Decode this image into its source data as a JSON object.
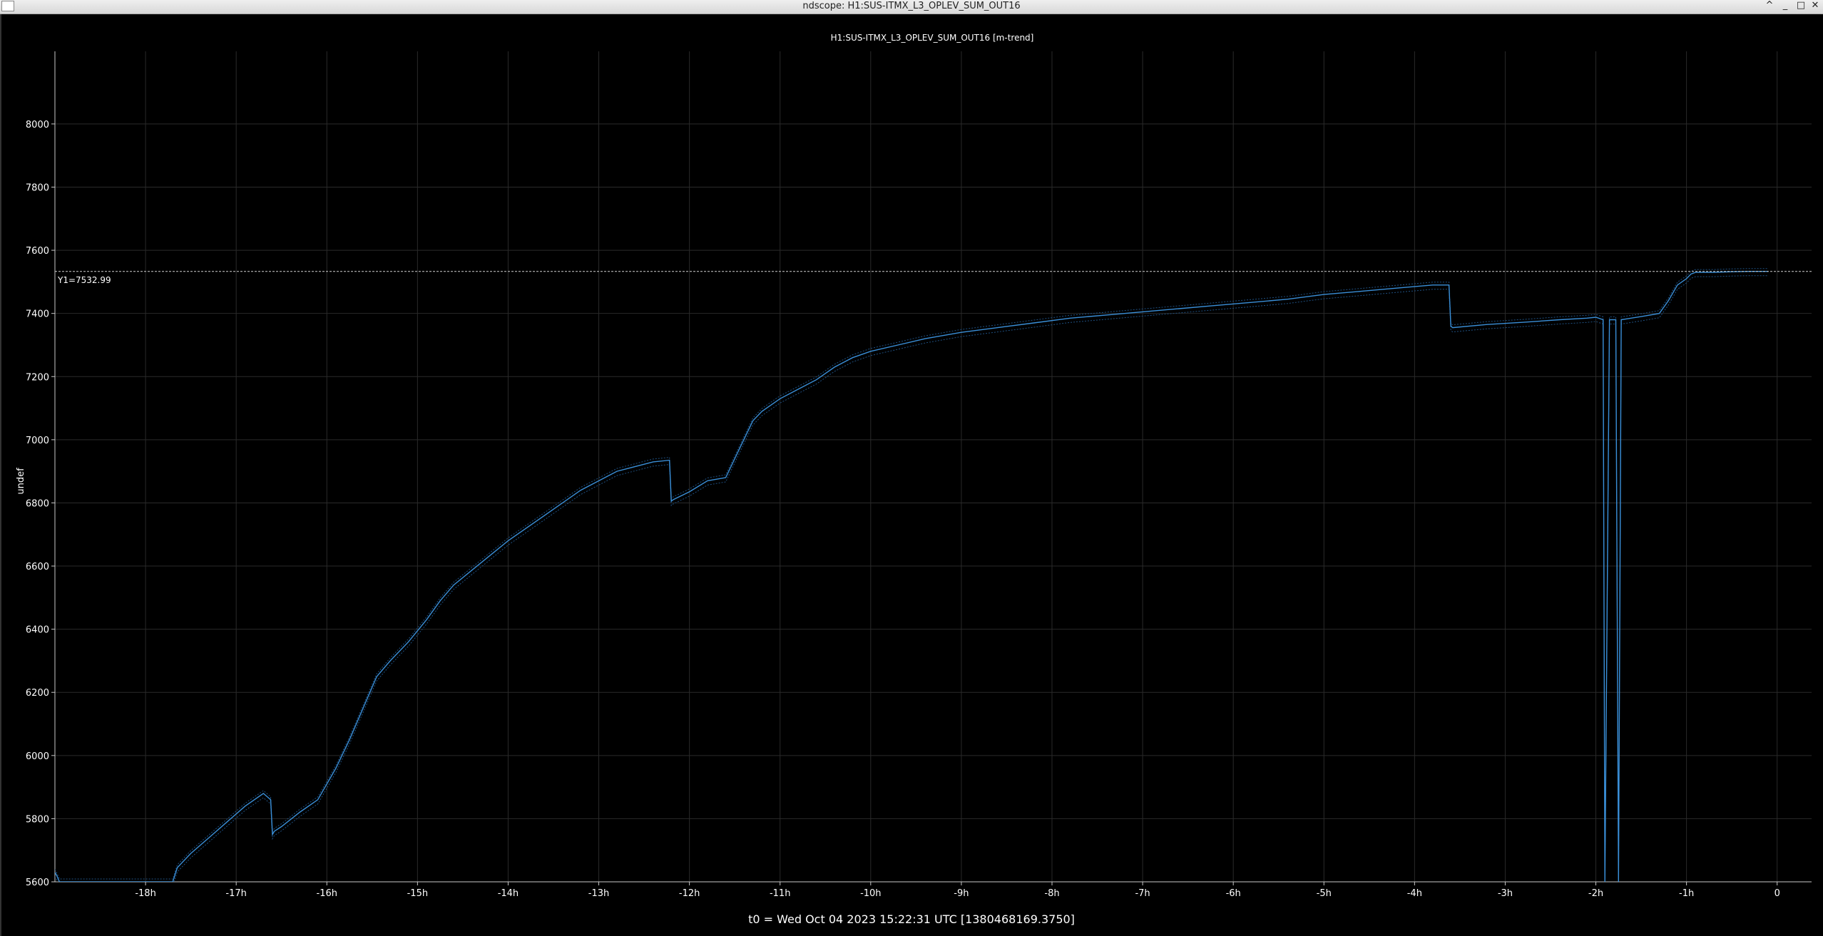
{
  "window": {
    "title": "ndscope: H1:SUS-ITMX_L3_OPLEV_SUM_OUT16",
    "buttons": [
      "^",
      "_",
      "□",
      "✕"
    ]
  },
  "plot": {
    "title": "H1:SUS-ITMX_L3_OPLEV_SUM_OUT16 [m-trend]",
    "ylabel": "undef",
    "cursor_label": "Y1=7532.99",
    "footer": "t0 = Wed Oct 04 2023 15:22:31 UTC [1380468169.3750]",
    "colors": {
      "background": "#000000",
      "trace": "#3a8fd8",
      "trace_dim": "#1e4f80",
      "axis": "#c8c8c8",
      "grid": "#2a2a2a",
      "cursor": "#d0d0d0"
    }
  },
  "chart_data": {
    "type": "line",
    "xlabel": "",
    "ylabel": "undef",
    "xlim": [
      -19.0,
      0.38
    ],
    "ylim": [
      5600,
      8230
    ],
    "xticks": [
      -18,
      -17,
      -16,
      -15,
      -14,
      -13,
      -12,
      -11,
      -10,
      -9,
      -8,
      -7,
      -6,
      -5,
      -4,
      -3,
      -2,
      -1,
      0
    ],
    "xtick_labels": [
      "-18h",
      "-17h",
      "-16h",
      "-15h",
      "-14h",
      "-13h",
      "-12h",
      "-11h",
      "-10h",
      "-9h",
      "-8h",
      "-7h",
      "-6h",
      "-5h",
      "-4h",
      "-3h",
      "-2h",
      "-1h",
      "0"
    ],
    "yticks": [
      5600,
      5800,
      6000,
      6200,
      6400,
      6600,
      6800,
      7000,
      7200,
      7400,
      7600,
      7800,
      8000
    ],
    "ytick_labels": [
      "5600",
      "5800",
      "6000",
      "6200",
      "6400",
      "6600",
      "6800",
      "7000",
      "7200",
      "7400",
      "7600",
      "7800",
      "8000"
    ],
    "grid": true,
    "cursor_y": 7532.99,
    "x_unit": "hours relative to t0",
    "series": [
      {
        "role": "mean",
        "x": [
          -19.0,
          -18.98,
          -18.95,
          -17.7,
          -17.65,
          -17.5,
          -17.3,
          -17.1,
          -16.9,
          -16.7,
          -16.62,
          -16.6,
          -16.58,
          -16.5,
          -16.3,
          -16.1,
          -15.9,
          -15.75,
          -15.6,
          -15.45,
          -15.3,
          -15.1,
          -14.9,
          -14.75,
          -14.6,
          -14.3,
          -14.0,
          -13.6,
          -13.2,
          -12.8,
          -12.4,
          -12.22,
          -12.2,
          -12.18,
          -12.0,
          -11.8,
          -11.6,
          -11.45,
          -11.3,
          -11.2,
          -11.0,
          -10.8,
          -10.6,
          -10.4,
          -10.2,
          -10.0,
          -9.7,
          -9.4,
          -9.0,
          -8.6,
          -8.2,
          -7.8,
          -7.4,
          -7.0,
          -6.6,
          -6.2,
          -5.8,
          -5.4,
          -5.0,
          -4.6,
          -4.2,
          -3.8,
          -3.62,
          -3.6,
          -3.58,
          -3.2,
          -2.8,
          -2.4,
          -2.1,
          -2.0,
          -1.92,
          -1.9,
          -1.85,
          -1.78,
          -1.75,
          -1.72,
          -1.5,
          -1.3,
          -1.2,
          -1.1,
          -1.0,
          -0.95,
          -0.9,
          -0.7,
          -0.5,
          -0.3,
          -0.1
        ],
        "y": [
          5630,
          5620,
          5600,
          5600,
          5645,
          5690,
          5740,
          5790,
          5840,
          5880,
          5860,
          5750,
          5760,
          5775,
          5820,
          5860,
          5960,
          6050,
          6150,
          6250,
          6300,
          6360,
          6430,
          6490,
          6540,
          6610,
          6680,
          6760,
          6840,
          6900,
          6930,
          6935,
          6805,
          6810,
          6835,
          6870,
          6880,
          6970,
          7060,
          7090,
          7130,
          7160,
          7190,
          7230,
          7260,
          7280,
          7300,
          7320,
          7340,
          7355,
          7370,
          7385,
          7395,
          7405,
          7415,
          7425,
          7435,
          7445,
          7460,
          7470,
          7480,
          7490,
          7490,
          7360,
          7355,
          7365,
          7372,
          7380,
          7385,
          7388,
          7380,
          5600,
          7380,
          7380,
          5600,
          7380,
          7390,
          7400,
          7440,
          7490,
          7510,
          7525,
          7530,
          7530,
          7532,
          7533,
          7533
        ]
      }
    ]
  }
}
